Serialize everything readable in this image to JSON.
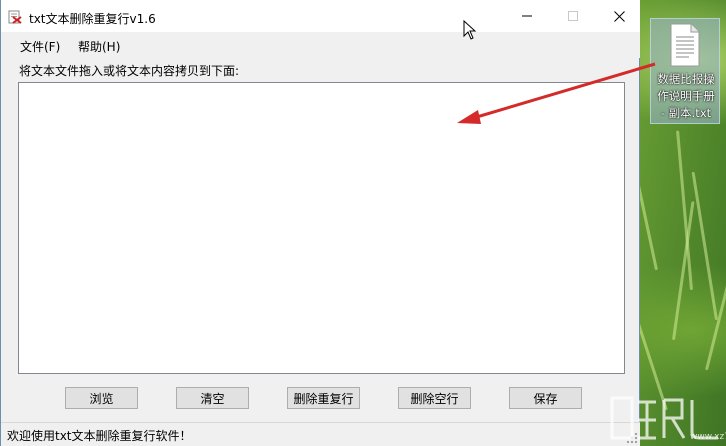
{
  "window": {
    "title": "txt文本删除重复行v1.6",
    "minimize_glyph": "—",
    "maximize_glyph": "☐",
    "close_glyph": "✕"
  },
  "menu": {
    "file": "文件(F)",
    "help": "帮助(H)"
  },
  "main": {
    "drop_label": "将文本文件拖入或将文本内容拷贝到下面:",
    "textarea_value": ""
  },
  "buttons": {
    "browse": "浏览",
    "clear": "清空",
    "dedup": "删除重复行",
    "remove_blank": "删除空行",
    "save": "保存"
  },
  "status": {
    "text": "欢迎使用txt文本删除重复行软件！"
  },
  "desktop": {
    "file_label_line1": "数据比报操",
    "file_label_line2": "作说明手册",
    "file_label_line3": "- 副本.txt"
  },
  "watermark": {
    "text": "www.xz7.com"
  },
  "colors": {
    "window_bg": "#f0f0f0",
    "arrow": "#d42a2a",
    "selection": "#99b4d1"
  },
  "icons": {
    "app": "app-icon",
    "file": "text-file-icon",
    "cursor": "mouse-pointer-icon",
    "arrow": "red-arrow-annotation"
  }
}
